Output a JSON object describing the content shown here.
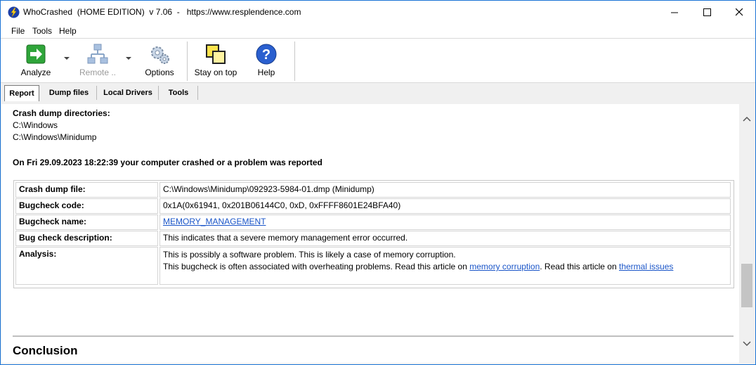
{
  "window": {
    "title": "WhoCrashed  (HOME EDITION)  v 7.06  -   https://www.resplendence.com"
  },
  "menu": {
    "file": "File",
    "tools": "Tools",
    "help": "Help"
  },
  "toolbar": {
    "analyze": "Analyze",
    "remote": "Remote ..",
    "options": "Options",
    "stay_on_top": "Stay on top",
    "help": "Help"
  },
  "tabs": {
    "report": "Report",
    "dump_files": "Dump files",
    "local_drivers": "Local Drivers",
    "tools": "Tools"
  },
  "report": {
    "crash_dirs_title": "Crash dump directories:",
    "crash_dirs": [
      "C:\\Windows",
      "C:\\Windows\\Minidump"
    ],
    "crash_heading": "On Fri 29.09.2023 18:22:39 your computer crashed or a problem was reported",
    "rows": [
      {
        "key": "Crash dump file:",
        "value": "C:\\Windows\\Minidump\\092923-5984-01.dmp (Minidump)"
      },
      {
        "key": "Bugcheck code:",
        "value": "0x1A(0x61941, 0x201B06144C0, 0xD, 0xFFFF8601E24BFA40)"
      },
      {
        "key": "Bugcheck name:",
        "value": "MEMORY_MANAGEMENT"
      },
      {
        "key": "Bug check description:",
        "value": "This indicates that a severe memory management error occurred."
      },
      {
        "key": "Analysis:",
        "value": "This is possibly a software problem. This is likely a case of memory corruption."
      }
    ],
    "analysis_line2_a": "This bugcheck is often associated with overheating problems. Read this article on ",
    "analysis_link1": "memory corruption",
    "analysis_line2_b": ". Read this article on ",
    "analysis_link2": "thermal issues",
    "conclusion": "Conclusion"
  }
}
